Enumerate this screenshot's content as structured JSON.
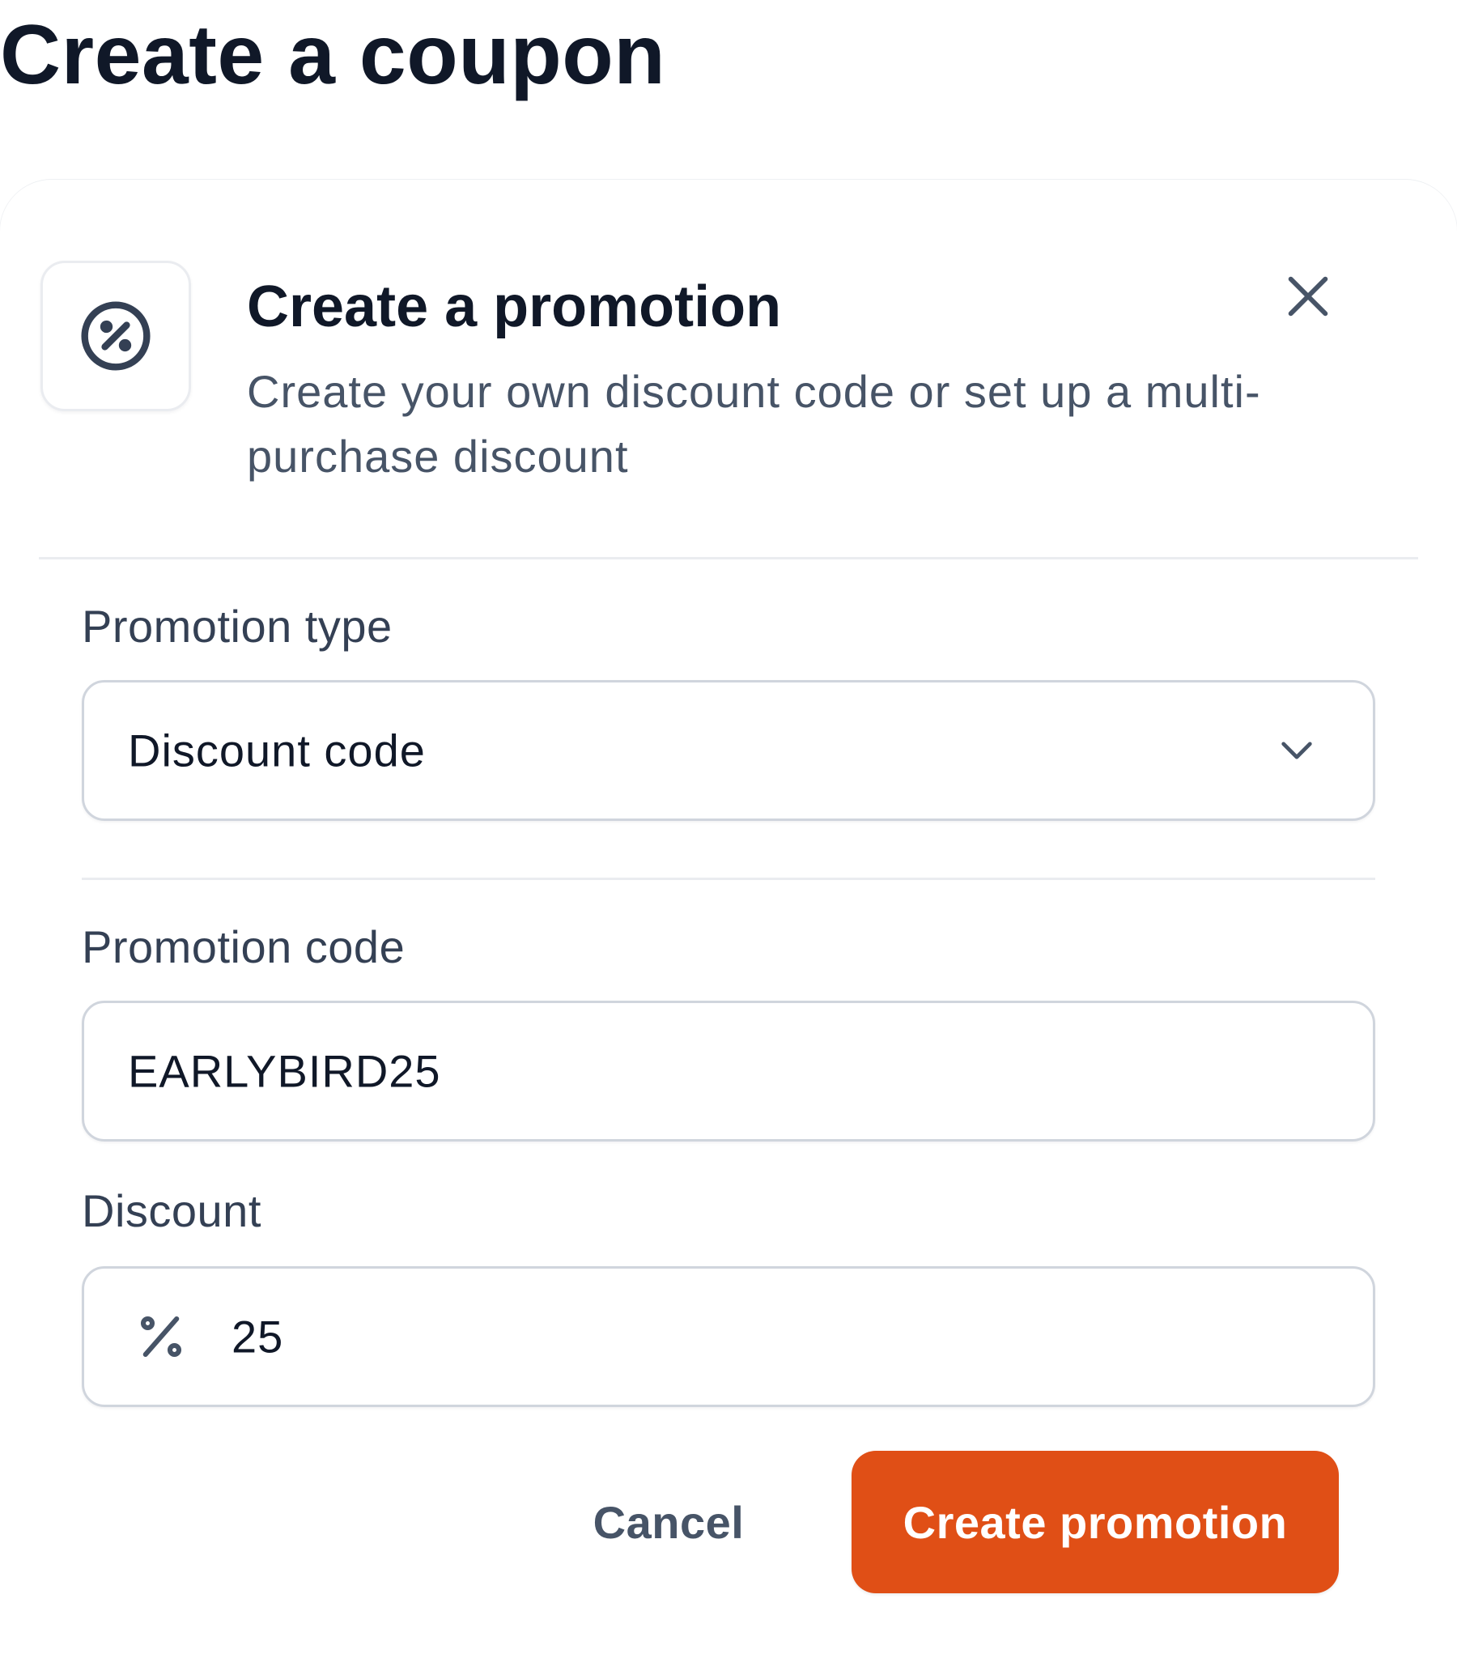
{
  "page": {
    "title": "Create a coupon"
  },
  "modal": {
    "icon": "percent-badge-icon",
    "title": "Create a promotion",
    "subtitle": "Create your own discount code or set up a multi-purchase discount",
    "close_icon": "close-icon"
  },
  "form": {
    "promotion_type": {
      "label": "Promotion type",
      "selected": "Discount code",
      "icon": "chevron-down-icon"
    },
    "promotion_code": {
      "label": "Promotion code",
      "value": "EARLYBIRD25"
    },
    "discount": {
      "label": "Discount",
      "prefix_icon": "percent-icon",
      "value": "25"
    }
  },
  "actions": {
    "cancel_label": "Cancel",
    "submit_label": "Create promotion"
  },
  "colors": {
    "accent": "#e04f16",
    "heading": "#101828",
    "muted_text": "#475467",
    "label_text": "#344054",
    "border": "#d0d5dd"
  }
}
